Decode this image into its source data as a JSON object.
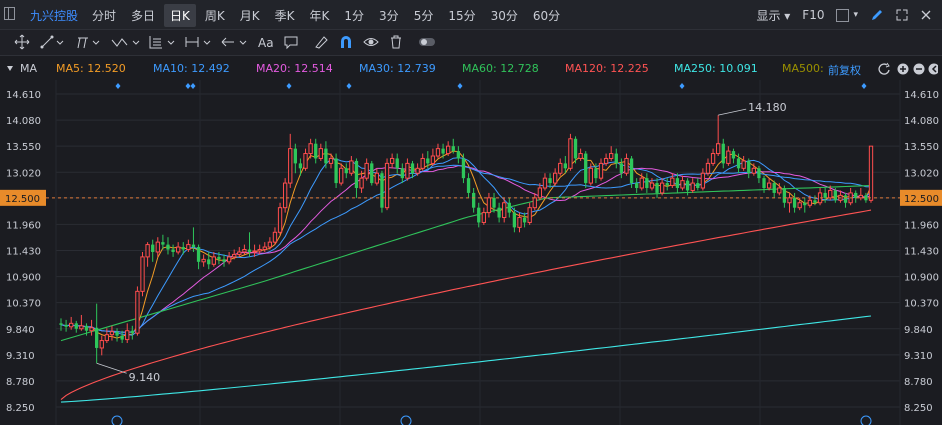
{
  "header": {
    "stock_name": "九兴控股",
    "tabs": [
      "分时",
      "多日",
      "日K",
      "周K",
      "月K",
      "季K",
      "年K",
      "1分",
      "3分",
      "5分",
      "15分",
      "30分",
      "60分"
    ],
    "active_tab": "日K",
    "display_label": "显示",
    "f10_label": "F10"
  },
  "toolbar": {
    "text_tool": "Aa"
  },
  "ma": {
    "label": "MA",
    "items": [
      {
        "text": "MA5: 12.520",
        "color": "#f39c26"
      },
      {
        "text": "MA10: 12.492",
        "color": "#3d9bff"
      },
      {
        "text": "MA20: 12.514",
        "color": "#e45be0"
      },
      {
        "text": "MA30: 12.739",
        "color": "#3d9bff"
      },
      {
        "text": "MA60: 12.728",
        "color": "#30c25a"
      },
      {
        "text": "MA120: 12.225",
        "color": "#ff5353"
      },
      {
        "text": "MA250: 10.091",
        "color": "#3fe7e6"
      },
      {
        "text": "MA500:",
        "color": "#9a9000"
      }
    ],
    "adjust": "前复权"
  },
  "chart_data": {
    "type": "candlestick",
    "y_ticks": [
      "14.610",
      "14.080",
      "13.550",
      "13.020",
      "12.500",
      "11.960",
      "11.430",
      "10.900",
      "10.370",
      "9.840",
      "9.310",
      "8.780",
      "8.250"
    ],
    "y_range": [
      8.25,
      14.61
    ],
    "current_price": "12.500",
    "high_label": "14.180",
    "low_label": "9.140",
    "up_color": "#ff4d4d",
    "down_color": "#2ec65a",
    "ohlc": [
      [
        9.95,
        9.92,
        10.05,
        9.8
      ],
      [
        9.92,
        9.88,
        10.02,
        9.78
      ],
      [
        9.88,
        9.95,
        10.08,
        9.82
      ],
      [
        9.95,
        9.84,
        10.0,
        9.76
      ],
      [
        9.84,
        9.9,
        10.12,
        9.8
      ],
      [
        9.9,
        9.8,
        9.95,
        9.7
      ],
      [
        9.8,
        9.86,
        10.02,
        9.7
      ],
      [
        9.86,
        9.45,
        10.35,
        9.14
      ],
      [
        9.45,
        9.6,
        9.7,
        9.3
      ],
      [
        9.6,
        9.72,
        9.85,
        9.55
      ],
      [
        9.72,
        9.78,
        9.9,
        9.6
      ],
      [
        9.78,
        9.7,
        9.85,
        9.58
      ],
      [
        9.7,
        9.62,
        9.8,
        9.55
      ],
      [
        9.62,
        9.8,
        9.95,
        9.55
      ],
      [
        9.8,
        9.75,
        9.9,
        9.62
      ],
      [
        9.75,
        10.6,
        10.7,
        9.7
      ],
      [
        10.6,
        11.3,
        11.4,
        10.5
      ],
      [
        11.3,
        11.55,
        11.6,
        11.1
      ],
      [
        11.55,
        11.4,
        11.65,
        11.2
      ],
      [
        11.4,
        11.6,
        11.7,
        11.3
      ],
      [
        11.6,
        11.55,
        11.75,
        11.45
      ],
      [
        11.55,
        11.45,
        11.7,
        11.35
      ],
      [
        11.45,
        11.4,
        11.55,
        11.3
      ],
      [
        11.4,
        11.5,
        11.6,
        11.35
      ],
      [
        11.5,
        11.45,
        11.6,
        11.35
      ],
      [
        11.45,
        11.55,
        11.65,
        11.4
      ],
      [
        11.55,
        11.5,
        11.9,
        11.4
      ],
      [
        11.5,
        11.2,
        11.55,
        11.05
      ],
      [
        11.2,
        11.25,
        11.35,
        11.1
      ],
      [
        11.25,
        11.15,
        11.4,
        11.05
      ],
      [
        11.15,
        11.3,
        11.4,
        11.1
      ],
      [
        11.3,
        11.25,
        11.4,
        11.15
      ],
      [
        11.25,
        11.2,
        11.35,
        11.1
      ],
      [
        11.2,
        11.3,
        11.4,
        11.15
      ],
      [
        11.3,
        11.35,
        11.45,
        11.25
      ],
      [
        11.35,
        11.4,
        11.5,
        11.3
      ],
      [
        11.4,
        11.45,
        11.55,
        11.35
      ],
      [
        11.45,
        11.4,
        11.8,
        11.3
      ],
      [
        11.4,
        11.42,
        11.55,
        11.3
      ],
      [
        11.42,
        11.45,
        11.55,
        11.35
      ],
      [
        11.45,
        11.5,
        11.6,
        11.4
      ],
      [
        11.5,
        11.6,
        11.7,
        11.45
      ],
      [
        11.6,
        11.8,
        11.9,
        11.55
      ],
      [
        11.8,
        12.3,
        12.4,
        11.75
      ],
      [
        12.3,
        12.8,
        12.9,
        12.2
      ],
      [
        12.8,
        13.5,
        13.8,
        12.7
      ],
      [
        13.5,
        13.2,
        13.6,
        13.0
      ],
      [
        13.2,
        13.1,
        13.3,
        12.95
      ],
      [
        13.1,
        13.4,
        13.5,
        13.05
      ],
      [
        13.4,
        13.6,
        13.7,
        13.3
      ],
      [
        13.6,
        13.3,
        13.7,
        13.2
      ],
      [
        13.3,
        13.5,
        13.6,
        13.25
      ],
      [
        13.5,
        13.2,
        13.65,
        13.1
      ],
      [
        13.2,
        13.3,
        13.4,
        13.1
      ],
      [
        13.3,
        12.8,
        13.4,
        12.7
      ],
      [
        12.8,
        13.1,
        13.2,
        12.75
      ],
      [
        13.1,
        13.0,
        13.2,
        12.9
      ],
      [
        13.0,
        13.25,
        13.35,
        12.95
      ],
      [
        13.25,
        12.7,
        13.3,
        12.5
      ],
      [
        12.7,
        12.9,
        13.05,
        12.6
      ],
      [
        12.9,
        13.2,
        13.3,
        12.85
      ],
      [
        13.2,
        12.8,
        13.25,
        12.75
      ],
      [
        12.8,
        13.0,
        13.1,
        12.75
      ],
      [
        13.0,
        12.3,
        13.05,
        12.2
      ],
      [
        12.3,
        13.2,
        13.3,
        12.25
      ],
      [
        13.2,
        13.3,
        13.4,
        13.1
      ],
      [
        13.3,
        13.1,
        13.4,
        13.0
      ],
      [
        13.1,
        12.9,
        13.2,
        12.8
      ],
      [
        12.9,
        13.2,
        13.3,
        12.85
      ],
      [
        13.2,
        13.0,
        13.25,
        12.9
      ],
      [
        13.0,
        13.1,
        13.2,
        12.95
      ],
      [
        13.1,
        13.3,
        13.4,
        13.05
      ],
      [
        13.3,
        13.2,
        13.45,
        13.1
      ],
      [
        13.2,
        13.35,
        13.5,
        13.15
      ],
      [
        13.35,
        13.5,
        13.6,
        13.3
      ],
      [
        13.5,
        13.4,
        13.6,
        13.3
      ],
      [
        13.4,
        13.55,
        13.65,
        13.35
      ],
      [
        13.55,
        13.45,
        13.7,
        13.4
      ],
      [
        13.45,
        13.3,
        13.55,
        13.2
      ],
      [
        13.3,
        12.9,
        13.4,
        12.8
      ],
      [
        12.9,
        12.6,
        13.0,
        12.5
      ],
      [
        12.6,
        12.3,
        12.7,
        12.2
      ],
      [
        12.3,
        12.0,
        12.4,
        11.9
      ],
      [
        12.0,
        12.2,
        12.3,
        11.95
      ],
      [
        12.2,
        12.5,
        12.6,
        12.1
      ],
      [
        12.5,
        12.3,
        12.6,
        12.2
      ],
      [
        12.3,
        12.1,
        12.4,
        12.0
      ],
      [
        12.1,
        12.4,
        12.5,
        12.0
      ],
      [
        12.4,
        12.2,
        12.5,
        12.1
      ],
      [
        12.2,
        11.9,
        12.3,
        11.8
      ],
      [
        11.9,
        12.1,
        12.2,
        11.8
      ],
      [
        12.1,
        12.0,
        12.2,
        11.9
      ],
      [
        12.0,
        12.3,
        12.4,
        11.95
      ],
      [
        12.3,
        12.5,
        12.6,
        12.25
      ],
      [
        12.5,
        12.7,
        12.8,
        12.45
      ],
      [
        12.7,
        12.9,
        13.0,
        12.65
      ],
      [
        12.9,
        12.8,
        13.0,
        12.7
      ],
      [
        12.8,
        13.0,
        13.1,
        12.75
      ],
      [
        13.0,
        13.2,
        13.3,
        12.95
      ],
      [
        13.2,
        13.1,
        13.35,
        13.0
      ],
      [
        13.1,
        13.7,
        13.8,
        13.05
      ],
      [
        13.7,
        13.3,
        13.75,
        13.2
      ],
      [
        13.3,
        13.4,
        13.5,
        13.25
      ],
      [
        13.4,
        12.8,
        13.45,
        12.7
      ],
      [
        12.8,
        13.1,
        13.2,
        12.75
      ],
      [
        13.1,
        12.9,
        13.2,
        12.8
      ],
      [
        12.9,
        13.2,
        13.3,
        12.85
      ],
      [
        13.2,
        13.3,
        13.4,
        13.15
      ],
      [
        13.3,
        13.4,
        13.55,
        13.25
      ],
      [
        13.4,
        13.2,
        13.5,
        13.1
      ],
      [
        13.2,
        13.0,
        13.3,
        12.9
      ],
      [
        13.0,
        13.3,
        13.4,
        12.95
      ],
      [
        13.3,
        12.8,
        13.35,
        12.7
      ],
      [
        12.8,
        12.7,
        12.9,
        12.6
      ],
      [
        12.7,
        12.9,
        13.0,
        12.65
      ],
      [
        12.9,
        12.7,
        13.0,
        12.6
      ],
      [
        12.7,
        12.8,
        12.9,
        12.65
      ],
      [
        12.8,
        12.6,
        12.9,
        12.5
      ],
      [
        12.6,
        12.8,
        12.9,
        12.55
      ],
      [
        12.8,
        12.75,
        12.9,
        12.65
      ],
      [
        12.75,
        12.9,
        13.0,
        12.7
      ],
      [
        12.9,
        12.7,
        13.0,
        12.6
      ],
      [
        12.7,
        12.85,
        12.95,
        12.65
      ],
      [
        12.85,
        12.65,
        12.9,
        12.55
      ],
      [
        12.65,
        12.8,
        12.9,
        12.6
      ],
      [
        12.8,
        12.7,
        12.9,
        12.65
      ],
      [
        12.7,
        13.0,
        13.1,
        12.65
      ],
      [
        13.0,
        13.2,
        13.3,
        12.95
      ],
      [
        13.2,
        13.4,
        13.5,
        13.15
      ],
      [
        13.4,
        13.6,
        14.18,
        13.35
      ],
      [
        13.6,
        13.2,
        13.7,
        13.1
      ],
      [
        13.2,
        13.45,
        13.55,
        13.15
      ],
      [
        13.45,
        13.3,
        13.5,
        13.2
      ],
      [
        13.3,
        13.1,
        13.4,
        13.0
      ],
      [
        13.1,
        13.25,
        13.35,
        13.05
      ],
      [
        13.25,
        13.0,
        13.3,
        12.9
      ],
      [
        13.0,
        13.1,
        13.2,
        12.95
      ],
      [
        13.1,
        12.9,
        13.15,
        12.8
      ],
      [
        12.9,
        12.7,
        12.95,
        12.6
      ],
      [
        12.7,
        12.8,
        12.9,
        12.65
      ],
      [
        12.8,
        12.6,
        12.85,
        12.5
      ],
      [
        12.6,
        12.7,
        12.8,
        12.55
      ],
      [
        12.7,
        12.4,
        12.75,
        12.3
      ],
      [
        12.4,
        12.5,
        12.6,
        12.2
      ],
      [
        12.5,
        12.3,
        12.6,
        12.2
      ],
      [
        12.3,
        12.4,
        12.5,
        12.25
      ],
      [
        12.4,
        12.35,
        12.5,
        12.2
      ],
      [
        12.35,
        12.45,
        12.55,
        12.3
      ],
      [
        12.45,
        12.4,
        12.55,
        12.35
      ],
      [
        12.4,
        12.6,
        12.7,
        12.35
      ],
      [
        12.6,
        12.5,
        12.7,
        12.4
      ],
      [
        12.5,
        12.65,
        12.75,
        12.45
      ],
      [
        12.65,
        12.45,
        12.7,
        12.4
      ],
      [
        12.45,
        12.55,
        12.65,
        12.4
      ],
      [
        12.55,
        12.4,
        12.6,
        12.3
      ],
      [
        12.4,
        12.6,
        12.7,
        12.35
      ],
      [
        12.6,
        12.5,
        12.65,
        12.4
      ],
      [
        12.5,
        12.55,
        12.7,
        12.45
      ],
      [
        12.55,
        12.45,
        12.6,
        12.4
      ],
      [
        12.45,
        13.55,
        13.55,
        12.4
      ]
    ]
  }
}
